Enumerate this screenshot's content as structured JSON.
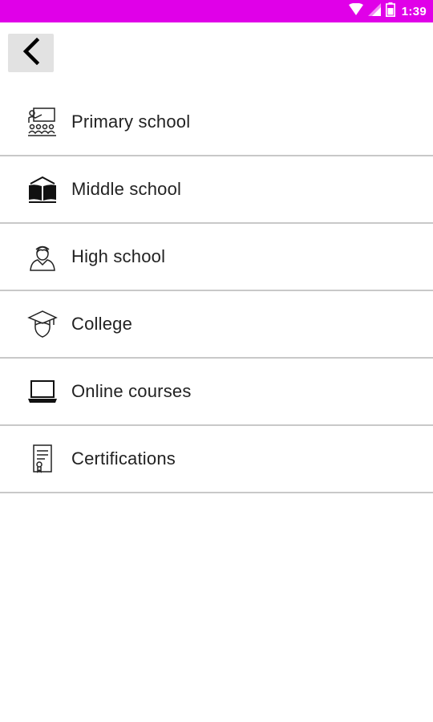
{
  "status_bar": {
    "time": "1:39",
    "background_color": "#e000e8",
    "icons": [
      "wifi-icon",
      "signal-icon",
      "battery-icon"
    ]
  },
  "toolbar": {
    "back_icon": "chevron-left-icon"
  },
  "menu": {
    "items": [
      {
        "label": "Primary school",
        "icon": "classroom-icon"
      },
      {
        "label": "Middle school",
        "icon": "open-book-icon"
      },
      {
        "label": "High school",
        "icon": "student-icon"
      },
      {
        "label": "College",
        "icon": "graduate-icon"
      },
      {
        "label": "Online courses",
        "icon": "laptop-icon"
      },
      {
        "label": "Certifications",
        "icon": "certificate-icon"
      }
    ]
  }
}
